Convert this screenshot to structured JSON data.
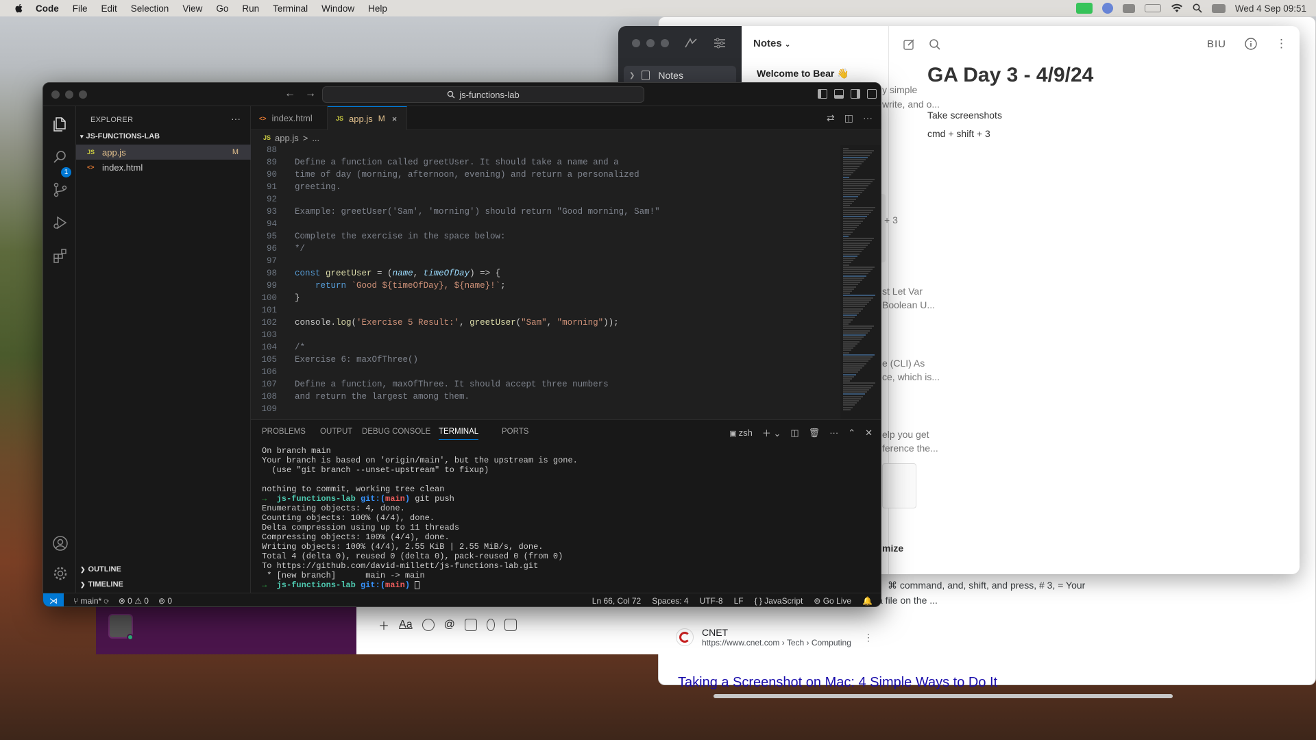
{
  "menubar": {
    "app": "Code",
    "items": [
      "File",
      "Edit",
      "Selection",
      "View",
      "Go",
      "Run",
      "Terminal",
      "Window",
      "Help"
    ],
    "clock": "Wed 4 Sep  09:51"
  },
  "browser": {
    "snippet1": "⌘ command, and, shift, and press, # 3, = Your",
    "snippet2": "a file on the ...",
    "source_name": "CNET",
    "source_url": "https://www.cnet.com › Tech › Computing",
    "result_title": "Taking a Screenshot on Mac: 4 Simple Ways to Do It"
  },
  "bear": {
    "sidebar_item": "Notes",
    "list_header": "Notes",
    "first_note": "Welcome to Bear 👋",
    "list_fragments": [
      "y simple",
      "write, and o...",
      "+ 3",
      "st Let Var",
      "Boolean U...",
      "e (CLI) As",
      "ce, which is...",
      "elp you get",
      "ference the...",
      "mize"
    ],
    "note_title": "GA Day 3 - 4/9/24",
    "note_line1": "Take screenshots",
    "note_line2": "cmd + shift + 3",
    "format_label": "BIU"
  },
  "vscode": {
    "search": "js-functions-lab",
    "explorer_title": "EXPLORER",
    "project": "JS-FUNCTIONS-LAB",
    "files": [
      {
        "icon": "JS",
        "name": "app.js",
        "badge": "M"
      },
      {
        "icon": "<>",
        "name": "index.html",
        "badge": ""
      }
    ],
    "scm_badge": "1",
    "outline": "OUTLINE",
    "timeline": "TIMELINE",
    "tabs": [
      {
        "icon": "<>",
        "name": "index.html",
        "badge": ""
      },
      {
        "icon": "JS",
        "name": "app.js",
        "badge": "M",
        "close": "×"
      }
    ],
    "breadcrumb": [
      "app.js",
      ">",
      "..."
    ],
    "panel_tabs": [
      "PROBLEMS",
      "OUTPUT",
      "DEBUG CONSOLE",
      "TERMINAL",
      "PORTS"
    ],
    "shell": "zsh",
    "status": {
      "branch": "main*",
      "errors": "0",
      "warnings": "0",
      "ports": "0",
      "cursor": "Ln 66, Col 72",
      "spaces": "Spaces: 4",
      "encoding": "UTF-8",
      "eol": "LF",
      "language": "{ } JavaScript",
      "live": "Go Live"
    }
  },
  "code_lines": [
    {
      "n": "88",
      "t": ""
    },
    {
      "n": "89",
      "t": "Define a function called greetUser. It should take a name and a"
    },
    {
      "n": "90",
      "t": "time of day (morning, afternoon, evening) and return a personalized"
    },
    {
      "n": "91",
      "t": "greeting."
    },
    {
      "n": "92",
      "t": ""
    },
    {
      "n": "93",
      "t": "Example: greetUser('Sam', 'morning') should return \"Good morning, Sam!\""
    },
    {
      "n": "94",
      "t": ""
    },
    {
      "n": "95",
      "t": "Complete the exercise in the space below:"
    },
    {
      "n": "96",
      "t": "*/"
    },
    {
      "n": "97",
      "t": ""
    },
    {
      "n": "98",
      "t": "const greetUser = (name, timeOfDay) => {"
    },
    {
      "n": "99",
      "t": "    return `Good ${timeOfDay}, ${name}!`;"
    },
    {
      "n": "100",
      "t": "}"
    },
    {
      "n": "101",
      "t": ""
    },
    {
      "n": "102",
      "t": "console.log('Exercise 5 Result:', greetUser(\"Sam\", \"morning\"));"
    },
    {
      "n": "103",
      "t": ""
    },
    {
      "n": "104",
      "t": "/*"
    },
    {
      "n": "105",
      "t": "Exercise 6: maxOfThree()"
    },
    {
      "n": "106",
      "t": ""
    },
    {
      "n": "107",
      "t": "Define a function, maxOfThree. It should accept three numbers"
    },
    {
      "n": "108",
      "t": "and return the largest among them."
    },
    {
      "n": "109",
      "t": ""
    }
  ],
  "terminal_lines": [
    "On branch main",
    "Your branch is based on 'origin/main', but the upstream is gone.",
    "  (use \"git branch --unset-upstream\" to fixup)",
    "",
    "nothing to commit, working tree clean",
    "→  js-functions-lab git:(main) git push",
    "Enumerating objects: 4, done.",
    "Counting objects: 100% (4/4), done.",
    "Delta compression using up to 11 threads",
    "Compressing objects: 100% (4/4), done.",
    "Writing objects: 100% (4/4), 2.55 KiB | 2.55 MiB/s, done.",
    "Total 4 (delta 0), reused 0 (delta 0), pack-reused 0 (from 0)",
    "To https://github.com/david-millett/js-functions-lab.git",
    " * [new branch]      main -> main",
    "→  js-functions-lab git:(main) "
  ]
}
